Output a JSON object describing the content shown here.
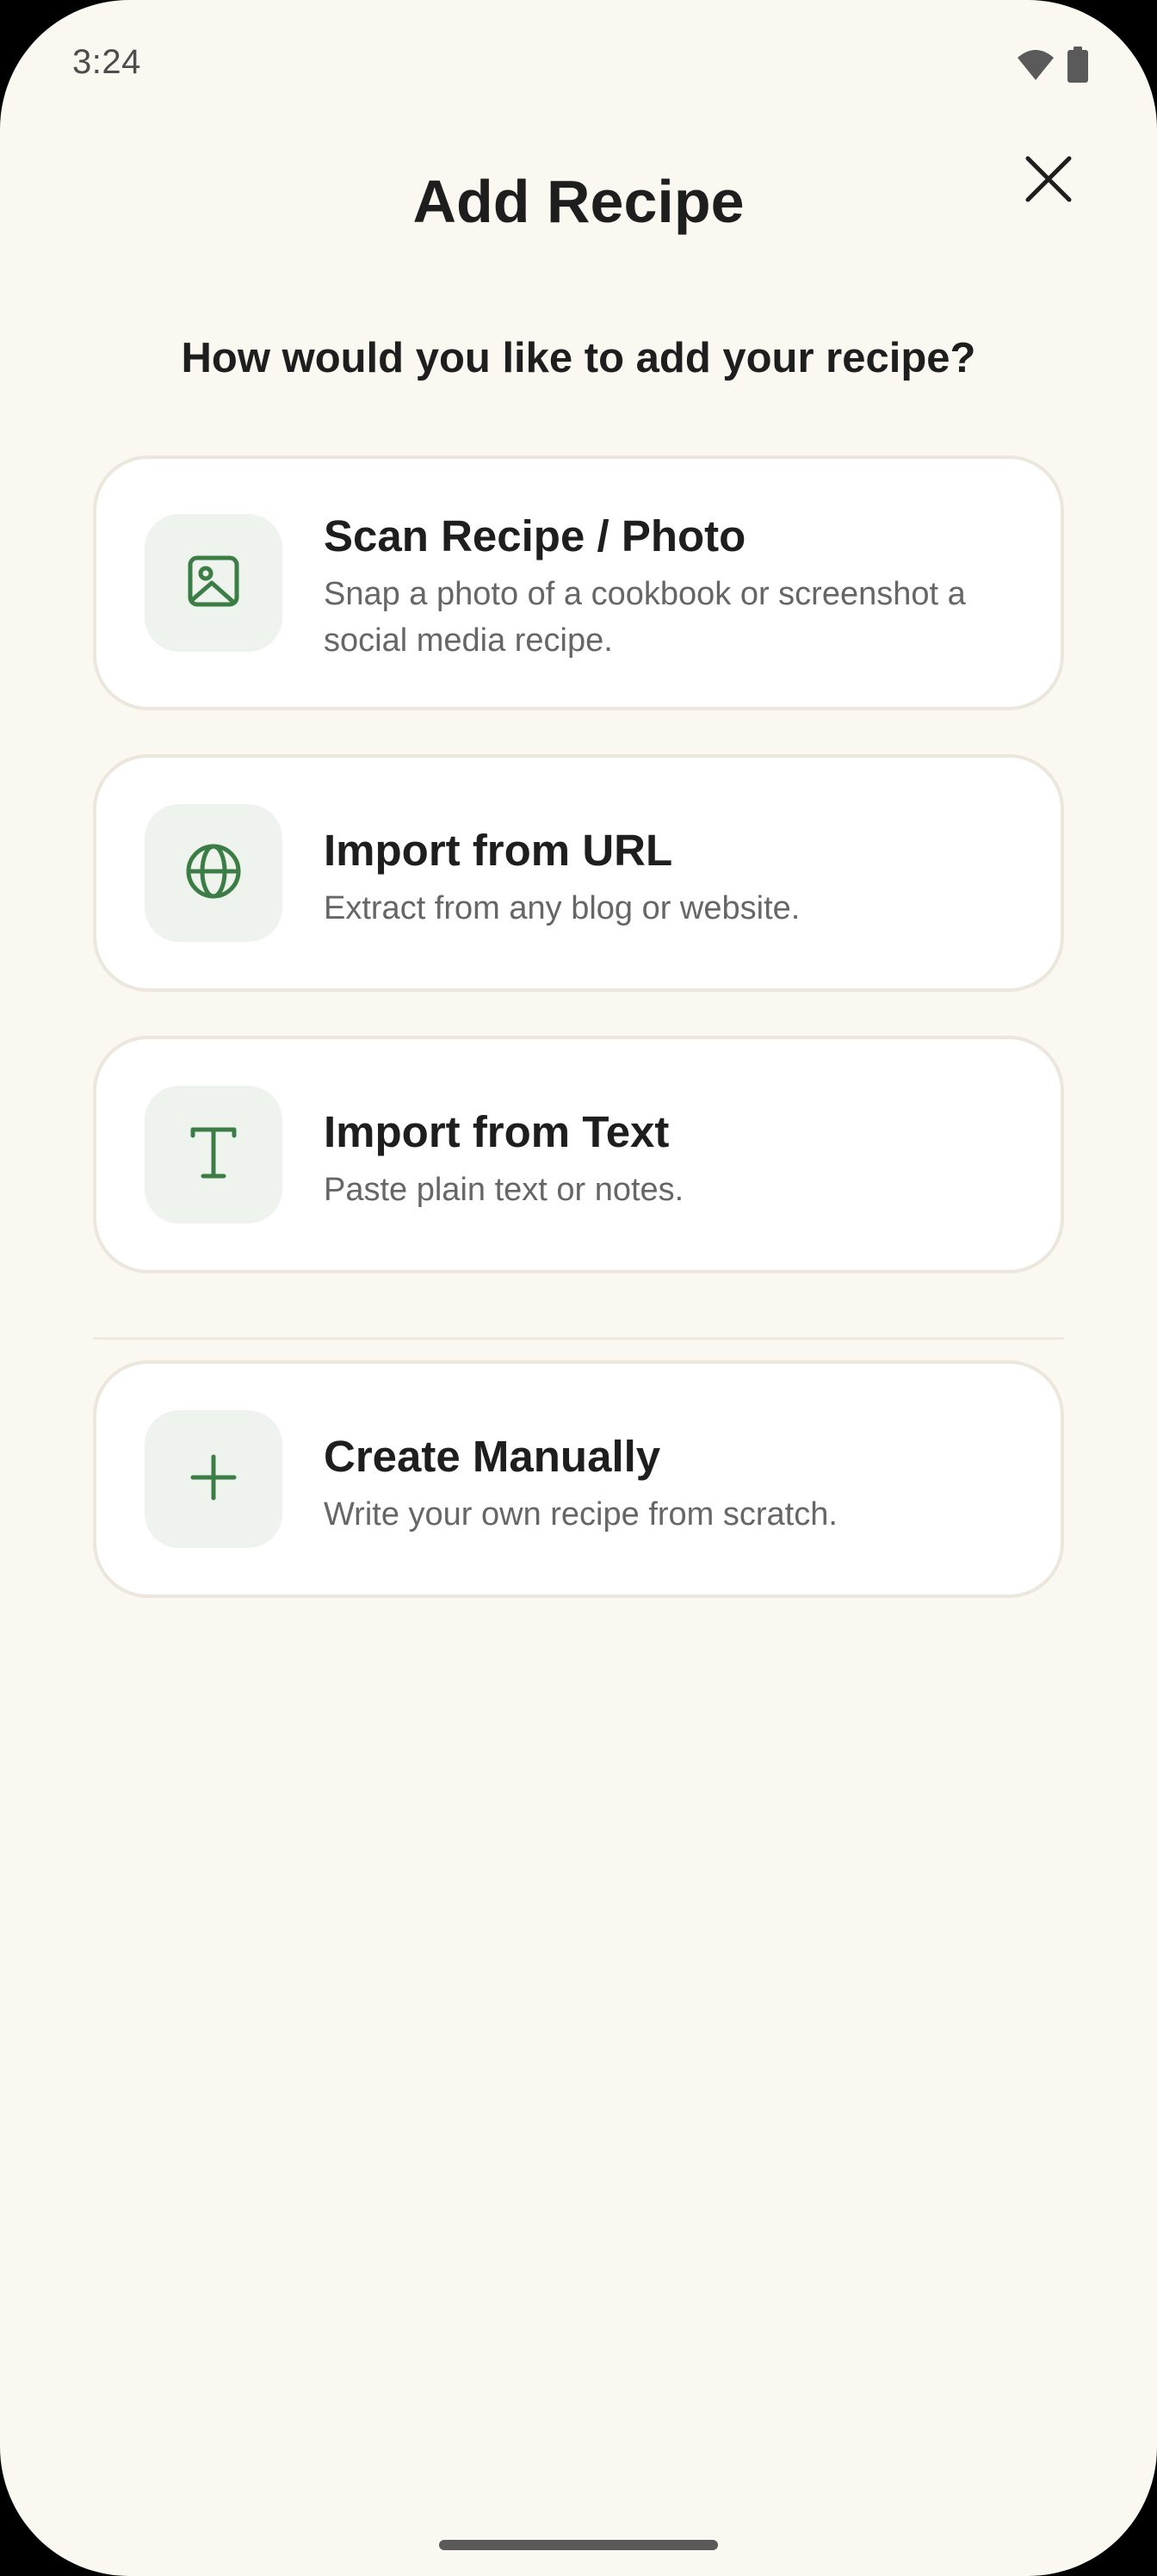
{
  "status_bar": {
    "time": "3:24",
    "wifi_icon": "wifi-icon",
    "battery_icon": "battery-icon"
  },
  "header": {
    "title": "Add Recipe",
    "close_icon": "close-icon"
  },
  "prompt": "How would you like to add your recipe?",
  "options": [
    {
      "icon": "image-icon",
      "title": "Scan Recipe / Photo",
      "description": "Snap a photo of a cookbook or screenshot a social media recipe."
    },
    {
      "icon": "globe-icon",
      "title": "Import from URL",
      "description": "Extract from any blog or website."
    },
    {
      "icon": "text-icon",
      "title": "Import from Text",
      "description": "Paste plain text or notes."
    },
    {
      "icon": "plus-icon",
      "title": "Create Manually",
      "description": "Write your own recipe from scratch."
    }
  ],
  "colors": {
    "background": "#FBF7F1",
    "card_background": "#FFFFFF",
    "card_border": "#ECE6DC",
    "icon_tile": "#EEF3EE",
    "accent_green": "#3B7D45",
    "text_primary": "#1E1E1E",
    "text_secondary": "#666666"
  }
}
